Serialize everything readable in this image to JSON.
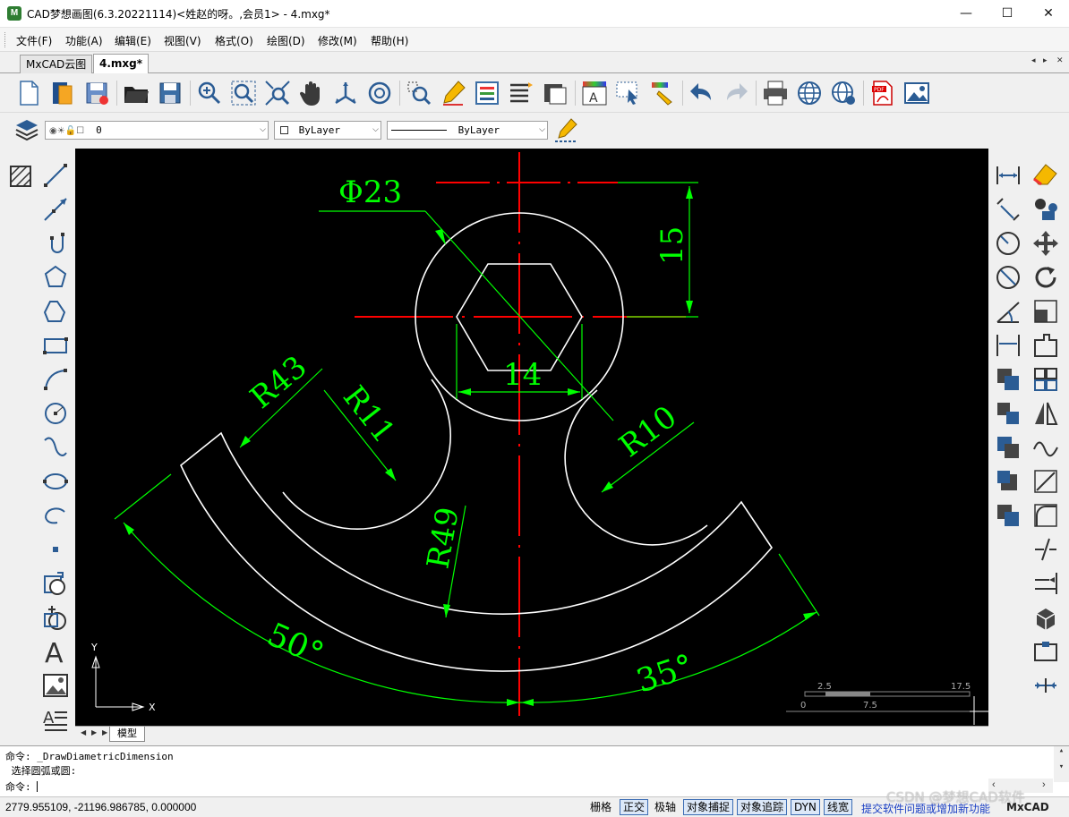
{
  "window": {
    "title": "CAD梦想画图(6.3.20221114)<姓赵的呀。,会员1> - 4.mxg*",
    "app_icon": "M",
    "minimize": "—",
    "maximize": "☐",
    "close": "✕"
  },
  "menu": {
    "items": [
      "文件(F)",
      "功能(A)",
      "编辑(E)",
      "视图(V)",
      "格式(O)",
      "绘图(D)",
      "修改(M)",
      "帮助(H)"
    ]
  },
  "tabs": {
    "items": [
      "MxCAD云图",
      "4.mxg*"
    ],
    "active_index": 1,
    "nav_prev": "◂",
    "nav_next": "▸",
    "close": "✕"
  },
  "layer_toolbar": {
    "layer_value": "0",
    "color_value": "ByLayer",
    "linetype_value": "ByLayer"
  },
  "drawing": {
    "dim_diameter": "Φ23",
    "dim_vertical": "15",
    "dim_hex": "14",
    "dim_r43": "R43",
    "dim_r11": "R11",
    "dim_r10": "R10",
    "dim_r49": "R49",
    "dim_angle_left": "50°",
    "dim_angle_right": "35°",
    "scale_top_left": "2.5",
    "scale_top_right": "17.5",
    "scale_bottom_left": "0",
    "scale_bottom_mid": "7.5",
    "ucs_y": "Y",
    "ucs_x": "X",
    "colors": {
      "background": "#000000",
      "geometry": "#ffffff",
      "centerline": "#ff0000",
      "dimension": "#00ff00"
    }
  },
  "model_tab": {
    "label": "模型"
  },
  "command": {
    "history": [
      "命令: _DrawDiametricDimension",
      " 选择圆弧或圆:"
    ],
    "prompt": "命令:"
  },
  "status": {
    "coordinates": "2779.955109,  -21196.986785,  0.000000",
    "buttons": [
      {
        "label": "栅格",
        "on": false
      },
      {
        "label": "正交",
        "on": true
      },
      {
        "label": "极轴",
        "on": false
      },
      {
        "label": "对象捕捉",
        "on": true
      },
      {
        "label": "对象追踪",
        "on": true
      },
      {
        "label": "DYN",
        "on": true
      },
      {
        "label": "线宽",
        "on": true
      }
    ],
    "feedback_link": "提交软件问题或增加新功能",
    "brand": "MxCAD"
  },
  "watermark": "CSDN @梦想CAD软件"
}
